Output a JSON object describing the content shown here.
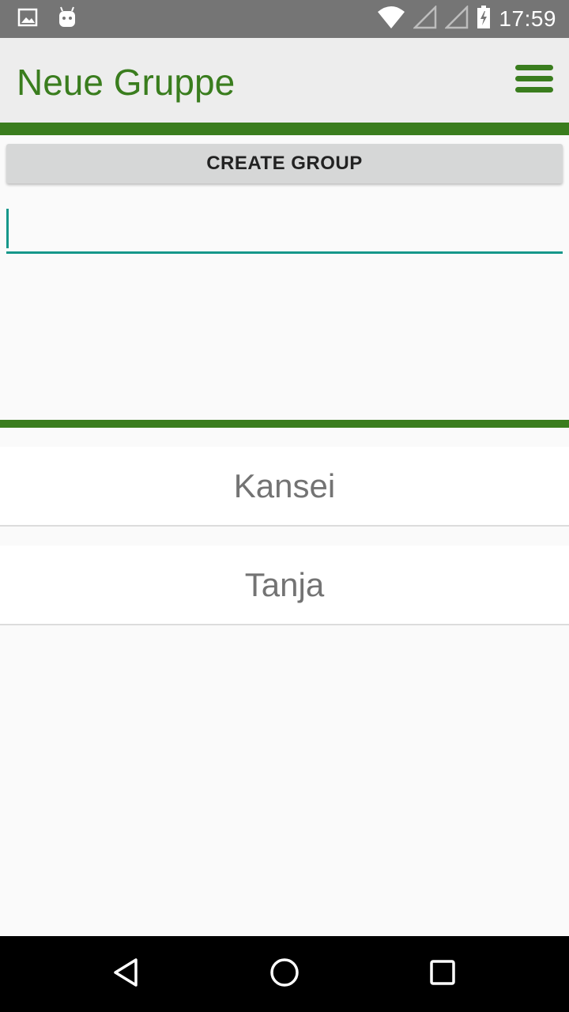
{
  "status_bar": {
    "time": "17:59",
    "icons": [
      "image-notification-icon",
      "android-debug-icon",
      "wifi-icon",
      "signal-icon",
      "signal-icon",
      "battery-charging-icon"
    ]
  },
  "app_bar": {
    "title": "Neue Gruppe",
    "menu_icon": "hamburger-menu-icon"
  },
  "main": {
    "create_button_label": "CREATE GROUP",
    "group_name_input": {
      "value": "",
      "placeholder": ""
    },
    "members": [
      {
        "name": "Kansei"
      },
      {
        "name": "Tanja"
      }
    ]
  },
  "nav_bar": {
    "icons": [
      "back-icon",
      "home-icon",
      "recents-icon"
    ]
  },
  "colors": {
    "accent_green": "#3a7d1e",
    "input_teal": "#15978a",
    "status_bar": "#757575"
  }
}
